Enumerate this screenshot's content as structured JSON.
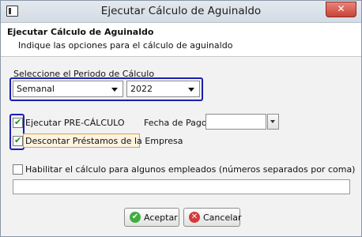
{
  "window": {
    "title": "Ejecutar Cálculo de Aguinaldo",
    "close_glyph": "✕"
  },
  "header": {
    "title": "Ejecutar Cálculo de Aguinaldo",
    "subtitle": "Indique las opciones para el cálculo de aguinaldo"
  },
  "period": {
    "label": "Seleccione el Periodo de Cálculo",
    "frequency_value": "Semanal",
    "year_value": "2022"
  },
  "options": {
    "precalculo": {
      "label": "Ejecutar PRE-CÁLCULO",
      "checked": true
    },
    "descontar": {
      "label": "Descontar Préstamos de la Empresa",
      "checked": true
    },
    "habilitar": {
      "label": "Habilitar el cálculo para algunos empleados (números separados por coma)",
      "checked": false
    }
  },
  "fecha_pago": {
    "label": "Fecha de Pago",
    "value": ""
  },
  "employees_input": {
    "value": ""
  },
  "buttons": {
    "accept": {
      "label": "Aceptar",
      "icon": "check-circle-icon",
      "color": "#3fae3f"
    },
    "cancel": {
      "label": "Cancelar",
      "icon": "cancel-circle-icon",
      "color": "#d23b3b"
    }
  },
  "colors": {
    "highlight": "#1a1fb0",
    "check": "#1f8f1f",
    "discount_bg": "#fdf3e1"
  }
}
